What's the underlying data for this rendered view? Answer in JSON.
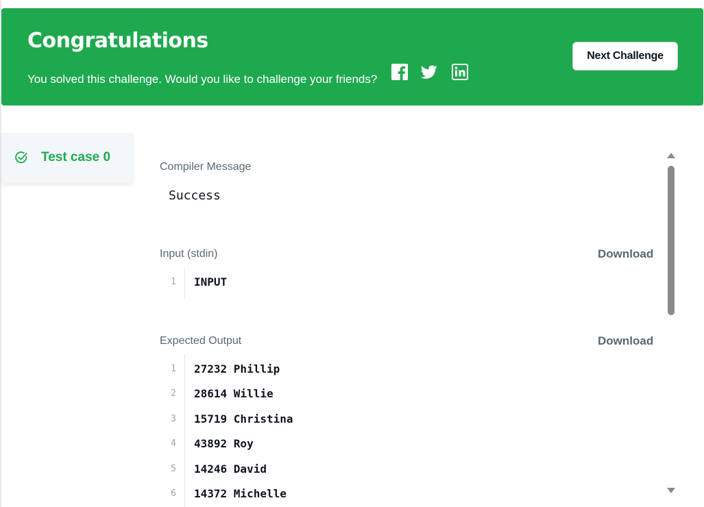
{
  "banner": {
    "title": "Congratulations",
    "subtitle": "You solved this challenge. Would you like to challenge your friends?",
    "social_icons": [
      "facebook-icon",
      "twitter-icon",
      "linkedin-icon"
    ],
    "next_button_label": "Next Challenge",
    "background_color": "#1ea94f"
  },
  "sidebar": {
    "test_case_label": "Test case 0",
    "status_icon": "check-circle-icon"
  },
  "compiler": {
    "label": "Compiler Message",
    "value": "Success"
  },
  "input": {
    "label": "Input (stdin)",
    "download_label": "Download",
    "lines": [
      {
        "num": "1",
        "text": "INPUT"
      }
    ]
  },
  "expected": {
    "label": "Expected Output",
    "download_label": "Download",
    "lines": [
      {
        "num": "1",
        "text": "27232 Phillip"
      },
      {
        "num": "2",
        "text": "28614 Willie"
      },
      {
        "num": "3",
        "text": "15719 Christina"
      },
      {
        "num": "4",
        "text": "43892 Roy"
      },
      {
        "num": "5",
        "text": "14246 David"
      },
      {
        "num": "6",
        "text": "14372 Michelle"
      }
    ]
  }
}
